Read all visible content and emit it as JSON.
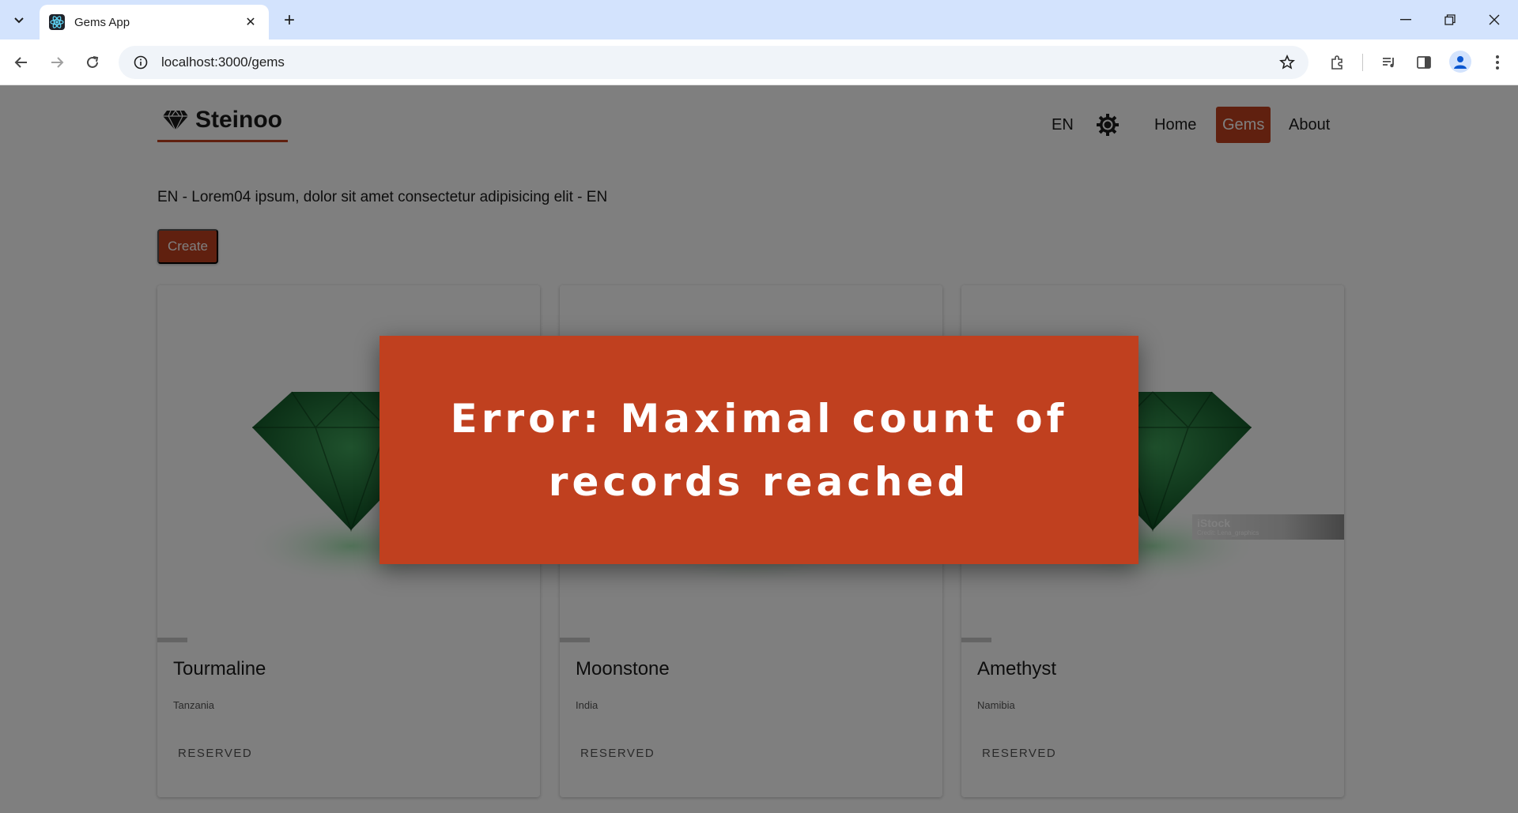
{
  "browser": {
    "tab_title": "Gems App",
    "url": "localhost:3000/gems"
  },
  "header": {
    "brand": "Steinoo",
    "lang": "EN",
    "nav": [
      {
        "label": "Home",
        "active": false
      },
      {
        "label": "Gems",
        "active": true
      },
      {
        "label": "About",
        "active": false
      }
    ]
  },
  "main": {
    "intro": "EN - Lorem04 ipsum, dolor sit amet consectetur adipisicing elit - EN",
    "create_label": "Create",
    "cards": [
      {
        "name": "Tourmaline",
        "origin": "Tanzania",
        "action": "RESERVED"
      },
      {
        "name": "Moonstone",
        "origin": "India",
        "action": "RESERVED"
      },
      {
        "name": "Amethyst",
        "origin": "Namibia",
        "action": "RESERVED",
        "watermark": "iStock",
        "watermark_credit": "Credit: Lena_graphics"
      }
    ]
  },
  "error": {
    "message": "Error: Maximal count of records reached"
  },
  "colors": {
    "accent": "#c0401f",
    "gem": "#1e7a34"
  }
}
